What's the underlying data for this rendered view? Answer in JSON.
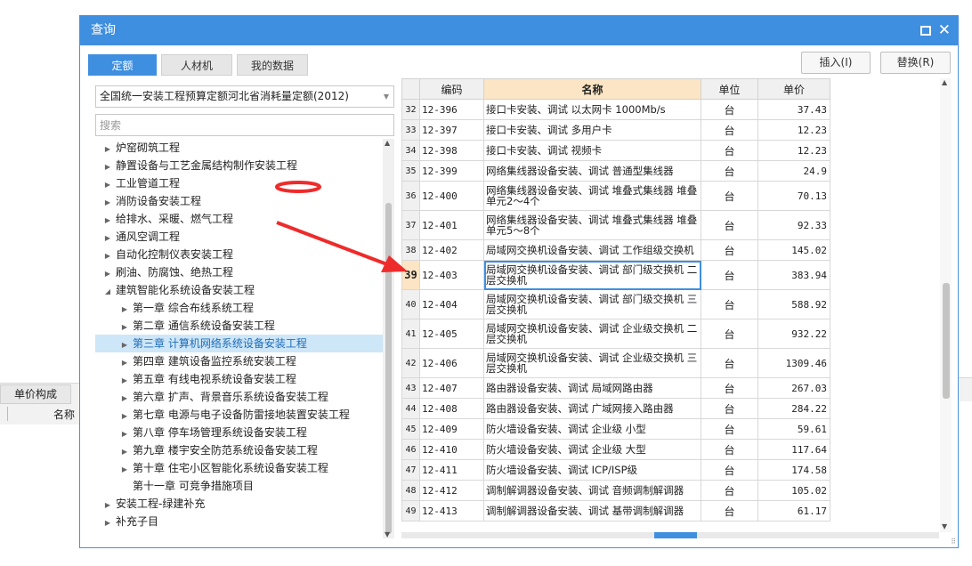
{
  "background": {
    "tab_label": "单价构成",
    "column_label": "名称"
  },
  "dialog": {
    "title": "查询",
    "tabs": [
      {
        "label": "定额"
      },
      {
        "label": "人材机"
      },
      {
        "label": "我的数据"
      }
    ],
    "insert_button": "插入(I)",
    "replace_button": "替换(R)",
    "library_select": "全国统一安装工程预算定额河北省消耗量定额(2012)",
    "search_placeholder": "搜索"
  },
  "tree": [
    {
      "label": "炉窑砌筑工程",
      "level": 0,
      "state": "collapsed"
    },
    {
      "label": "静置设备与工艺金属结构制作安装工程",
      "level": 0,
      "state": "collapsed"
    },
    {
      "label": "工业管道工程",
      "level": 0,
      "state": "collapsed"
    },
    {
      "label": "消防设备安装工程",
      "level": 0,
      "state": "collapsed"
    },
    {
      "label": "给排水、采暖、燃气工程",
      "level": 0,
      "state": "collapsed"
    },
    {
      "label": "通风空调工程",
      "level": 0,
      "state": "collapsed"
    },
    {
      "label": "自动化控制仪表安装工程",
      "level": 0,
      "state": "collapsed"
    },
    {
      "label": "刷油、防腐蚀、绝热工程",
      "level": 0,
      "state": "collapsed"
    },
    {
      "label": "建筑智能化系统设备安装工程",
      "level": 0,
      "state": "expanded"
    },
    {
      "label": "第一章 综合布线系统工程",
      "level": 1,
      "state": "collapsed"
    },
    {
      "label": "第二章 通信系统设备安装工程",
      "level": 1,
      "state": "collapsed"
    },
    {
      "label": "第三章 计算机网络系统设备安装工程",
      "level": 1,
      "state": "collapsed",
      "selected": true
    },
    {
      "label": "第四章 建筑设备监控系统安装工程",
      "level": 1,
      "state": "collapsed"
    },
    {
      "label": "第五章 有线电视系统设备安装工程",
      "level": 1,
      "state": "collapsed"
    },
    {
      "label": "第六章 扩声、背景音乐系统设备安装工程",
      "level": 1,
      "state": "collapsed"
    },
    {
      "label": "第七章 电源与电子设备防雷接地装置安装工程",
      "level": 1,
      "state": "collapsed"
    },
    {
      "label": "第八章 停车场管理系统设备安装工程",
      "level": 1,
      "state": "collapsed"
    },
    {
      "label": "第九章 楼宇安全防范系统设备安装工程",
      "level": 1,
      "state": "collapsed"
    },
    {
      "label": "第十章 住宅小区智能化系统设备安装工程",
      "level": 1,
      "state": "collapsed"
    },
    {
      "label": "第十一章 可竞争措施项目",
      "level": 1,
      "state": "leaf"
    },
    {
      "label": "安装工程-绿建补充",
      "level": 0,
      "state": "collapsed"
    },
    {
      "label": "补充子目",
      "level": 0,
      "state": "collapsed"
    }
  ],
  "table": {
    "headers": {
      "code": "编码",
      "name": "名称",
      "unit": "单位",
      "price": "单价"
    },
    "rows": [
      {
        "idx": "32",
        "code": "12-396",
        "name": "接口卡安装、调试 以太网卡 1000Mb/s",
        "unit": "台",
        "price": "37.43"
      },
      {
        "idx": "33",
        "code": "12-397",
        "name": "接口卡安装、调试 多用户卡",
        "unit": "台",
        "price": "12.23"
      },
      {
        "idx": "34",
        "code": "12-398",
        "name": "接口卡安装、调试 视频卡",
        "unit": "台",
        "price": "12.23"
      },
      {
        "idx": "35",
        "code": "12-399",
        "name": "网络集线器设备安装、调试 普通型集线器",
        "unit": "台",
        "price": "24.9"
      },
      {
        "idx": "36",
        "code": "12-400",
        "name": "网络集线器设备安装、调试 堆叠式集线器 堆叠单元2～4个",
        "unit": "台",
        "price": "70.13"
      },
      {
        "idx": "37",
        "code": "12-401",
        "name": "网络集线器设备安装、调试 堆叠式集线器 堆叠单元5～8个",
        "unit": "台",
        "price": "92.33"
      },
      {
        "idx": "38",
        "code": "12-402",
        "name": "局域网交换机设备安装、调试 工作组级交换机",
        "unit": "台",
        "price": "145.02"
      },
      {
        "idx": "39",
        "code": "12-403",
        "name": "局域网交换机设备安装、调试 部门级交换机 二层交换机",
        "unit": "台",
        "price": "383.94",
        "current": true
      },
      {
        "idx": "40",
        "code": "12-404",
        "name": "局域网交换机设备安装、调试 部门级交换机 三层交换机",
        "unit": "台",
        "price": "588.92"
      },
      {
        "idx": "41",
        "code": "12-405",
        "name": "局域网交换机设备安装、调试 企业级交换机 二层交换机",
        "unit": "台",
        "price": "932.22"
      },
      {
        "idx": "42",
        "code": "12-406",
        "name": "局域网交换机设备安装、调试 企业级交换机 三层交换机",
        "unit": "台",
        "price": "1309.46"
      },
      {
        "idx": "43",
        "code": "12-407",
        "name": "路由器设备安装、调试 局域网路由器",
        "unit": "台",
        "price": "267.03"
      },
      {
        "idx": "44",
        "code": "12-408",
        "name": "路由器设备安装、调试 广域网接入路由器",
        "unit": "台",
        "price": "284.22"
      },
      {
        "idx": "45",
        "code": "12-409",
        "name": "防火墙设备安装、调试 企业级 小型",
        "unit": "台",
        "price": "59.61"
      },
      {
        "idx": "46",
        "code": "12-410",
        "name": "防火墙设备安装、调试 企业级 大型",
        "unit": "台",
        "price": "117.64"
      },
      {
        "idx": "47",
        "code": "12-411",
        "name": "防火墙设备安装、调试 ICP/ISP级",
        "unit": "台",
        "price": "174.58"
      },
      {
        "idx": "48",
        "code": "12-412",
        "name": "调制解调器设备安装、调试 音频调制解调器",
        "unit": "台",
        "price": "105.02"
      },
      {
        "idx": "49",
        "code": "12-413",
        "name": "调制解调器设备安装、调试 基带调制解调器",
        "unit": "台",
        "price": "61.17"
      }
    ]
  },
  "colors": {
    "accent": "#3f8fe0",
    "header_highlight": "#fbe5c4",
    "annotation": "#ee2b2b",
    "selection": "#cde6f8"
  }
}
